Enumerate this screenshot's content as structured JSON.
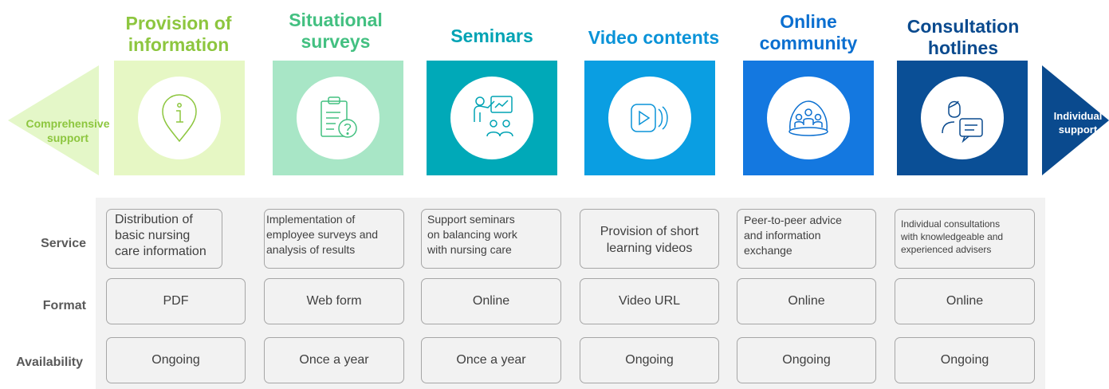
{
  "left_label": "Comprehensive\nsupport",
  "right_label": "Individual\nsupport",
  "row_labels": {
    "service": "Service",
    "format": "Format",
    "availability": "Availability"
  },
  "columns": [
    {
      "title": "Provision of\ninformation",
      "icon": "info-pin-icon",
      "color": "#8dc63f",
      "card_bg": "#e6f7c4",
      "service": "Distribution of\nbasic nursing\ncare information",
      "format": "PDF",
      "availability": "Ongoing"
    },
    {
      "title": "Situational\nsurveys",
      "icon": "survey-clipboard-icon",
      "color": "#43c081",
      "card_bg": "#a8e6c6",
      "service": "Implementation of\nemployee surveys and\nanalysis of results",
      "format": "Web form",
      "availability": "Once a year"
    },
    {
      "title": "Seminars",
      "icon": "seminar-presenter-icon",
      "color": "#00a3b4",
      "card_bg": "#00a9b8",
      "service": "Support seminars\non balancing work\nwith nursing care",
      "format": "Online",
      "availability": "Once a year"
    },
    {
      "title": "Video contents",
      "icon": "video-play-icon",
      "color": "#0a93d8",
      "card_bg": "#0a9ee2",
      "service": "Provision of short\nlearning videos",
      "format": "Video URL",
      "availability": "Ongoing"
    },
    {
      "title": "Online\ncommunity",
      "icon": "community-people-icon",
      "color": "#0b6fd0",
      "card_bg": "#1478e0",
      "service": "Peer-to-peer advice\nand information\nexchange",
      "format": "Online",
      "availability": "Ongoing"
    },
    {
      "title": "Consultation\nhotlines",
      "icon": "consultant-chat-icon",
      "color": "#0a4a8e",
      "card_bg": "#0a4f96",
      "service": "Individual consultations\nwith knowledgeable and\nexperienced advisers",
      "format": "Online",
      "availability": "Ongoing"
    }
  ]
}
